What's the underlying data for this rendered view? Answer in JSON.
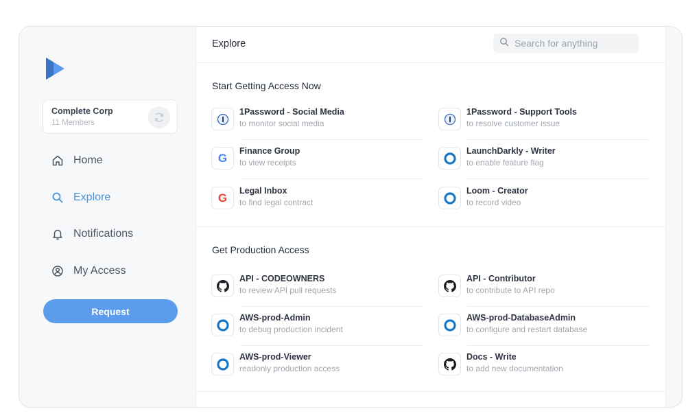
{
  "app": {
    "org": {
      "name": "Complete Corp",
      "members": "11 Members"
    },
    "nav": [
      {
        "label": "Home",
        "icon": "home-icon"
      },
      {
        "label": "Explore",
        "icon": "search-icon",
        "active": true
      },
      {
        "label": "Notifications",
        "icon": "bell-icon"
      },
      {
        "label": "My Access",
        "icon": "user-circle-icon"
      }
    ],
    "request_label": "Request",
    "accent": "#5b9cec"
  },
  "header": {
    "title": "Explore",
    "search_placeholder": "Search for anything"
  },
  "sections": [
    {
      "title": "Start Getting Access Now",
      "items": [
        {
          "name": "1Password - Social Media",
          "desc": "to monitor social media",
          "icon": "1password-icon"
        },
        {
          "name": "1Password - Support Tools",
          "desc": "to resolve customer issue",
          "icon": "1password-icon"
        },
        {
          "name": "Finance Group",
          "desc": "to view receipts",
          "icon": "google-icon"
        },
        {
          "name": "LaunchDarkly - Writer",
          "desc": "to enable feature flag",
          "icon": "ring-icon"
        },
        {
          "name": "Legal Inbox",
          "desc": "to find legal contract",
          "icon": "google-icon"
        },
        {
          "name": "Loom - Creator",
          "desc": "to record video",
          "icon": "ring-icon"
        }
      ]
    },
    {
      "title": "Get Production Access",
      "items": [
        {
          "name": "API - CODEOWNERS",
          "desc": "to review API pull requests",
          "icon": "github-icon"
        },
        {
          "name": "API - Contributor",
          "desc": "to contribute to API repo",
          "icon": "github-icon"
        },
        {
          "name": "AWS-prod-Admin",
          "desc": "to debug production incident",
          "icon": "ring-icon"
        },
        {
          "name": "AWS-prod-DatabaseAdmin",
          "desc": "to configure and restart database",
          "icon": "ring-icon"
        },
        {
          "name": "AWS-prod-Viewer",
          "desc": "readonly production access",
          "icon": "ring-icon"
        },
        {
          "name": "Docs - Write",
          "desc": "to add new documentation",
          "icon": "github-icon"
        }
      ]
    }
  ]
}
